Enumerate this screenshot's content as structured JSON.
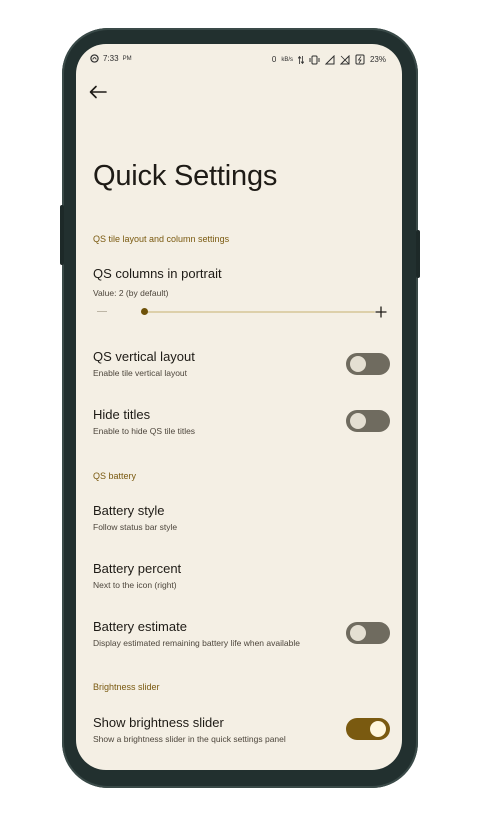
{
  "status_bar": {
    "time": "7:33",
    "ampm": "PM",
    "net_speed": "0",
    "net_unit": "kB/s",
    "battery": "23%"
  },
  "page": {
    "title": "Quick Settings"
  },
  "sections": {
    "qs_tile": {
      "header": "QS tile layout and column settings",
      "columns": {
        "title": "QS columns in portrait",
        "value_text": "Value: 2  (by default)",
        "value": 2
      },
      "vertical_layout": {
        "title": "QS vertical layout",
        "subtitle": "Enable tile vertical layout",
        "enabled": false
      },
      "hide_titles": {
        "title": "Hide titles",
        "subtitle": "Enable to hide QS tile titles",
        "enabled": false
      }
    },
    "qs_battery": {
      "header": "QS battery",
      "battery_style": {
        "title": "Battery style",
        "subtitle": "Follow status bar style"
      },
      "battery_percent": {
        "title": "Battery percent",
        "subtitle": "Next to the icon (right)"
      },
      "battery_estimate": {
        "title": "Battery estimate",
        "subtitle": "Display estimated remaining battery life when available",
        "enabled": false
      }
    },
    "brightness": {
      "header": "Brightness slider",
      "show_slider": {
        "title": "Show brightness slider",
        "subtitle": "Show a brightness slider in the quick settings panel",
        "enabled": true
      }
    }
  },
  "icons": {
    "back": "arrow-back-icon",
    "minus": "minus-icon",
    "plus": "plus-icon"
  },
  "colors": {
    "background": "#f4efe4",
    "accent": "#7a5a10",
    "toggle_off": "#6f6b5f",
    "frame": "#22302f"
  }
}
